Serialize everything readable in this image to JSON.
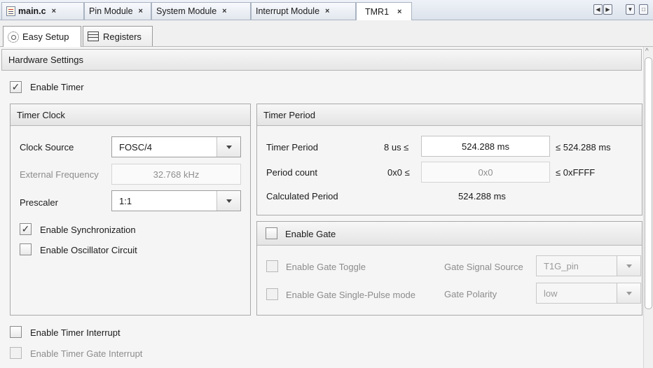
{
  "editor_tabs": [
    {
      "label": "main.c",
      "close": "×"
    },
    {
      "label": "Pin Module",
      "close": "×"
    },
    {
      "label": "System Module",
      "close": "×"
    },
    {
      "label": "Interrupt Module",
      "close": "×"
    },
    {
      "label": "TMR1",
      "close": "×"
    }
  ],
  "sub_tabs": {
    "easy_setup": "Easy Setup",
    "registers": "Registers"
  },
  "hardware": {
    "header": "Hardware Settings",
    "enable_timer": {
      "label": "Enable Timer",
      "checked": true
    },
    "enable_timer_interrupt": {
      "label": "Enable Timer Interrupt",
      "checked": false
    },
    "enable_timer_gate_interrupt": {
      "label": "Enable Timer Gate Interrupt",
      "checked": false
    }
  },
  "timer_clock": {
    "header": "Timer Clock",
    "clock_source_label": "Clock Source",
    "clock_source_value": "FOSC/4",
    "external_frequency_label": "External Frequency",
    "external_frequency_value": "32.768 kHz",
    "prescaler_label": "Prescaler",
    "prescaler_value": "1:1",
    "enable_sync": {
      "label": "Enable Synchronization",
      "checked": true
    },
    "enable_osc": {
      "label": "Enable Oscillator Circuit",
      "checked": false
    }
  },
  "timer_period": {
    "header": "Timer Period",
    "period_label": "Timer Period",
    "period_min": "8 us ≤",
    "period_value": "524.288 ms",
    "period_max": "≤ 524.288 ms",
    "count_label": "Period count",
    "count_min": "0x0 ≤",
    "count_value": "0x0",
    "count_max": "≤ 0xFFFF",
    "calc_label": "Calculated Period",
    "calc_value": "524.288 ms"
  },
  "gate": {
    "header_label": "Enable Gate",
    "enable_gate_checked": false,
    "toggle_label": "Enable Gate Toggle",
    "single_pulse_label": "Enable Gate Single-Pulse mode",
    "signal_source_label": "Gate Signal Source",
    "signal_source_value": "T1G_pin",
    "polarity_label": "Gate Polarity",
    "polarity_value": "low"
  },
  "glyphs": {
    "check": "✓",
    "nav_left": "◀",
    "nav_right": "▶",
    "nav_menu": "▼",
    "nav_restore": "□"
  }
}
